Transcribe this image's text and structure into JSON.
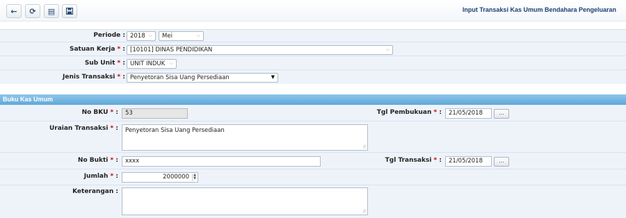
{
  "toolbar": {
    "buttons": [
      {
        "icon": "arrow-left-icon",
        "glyph": "←"
      },
      {
        "icon": "refresh-icon",
        "glyph": "⟳"
      },
      {
        "icon": "list-icon",
        "glyph": "▤"
      },
      {
        "icon": "save-icon",
        "glyph": "▪"
      }
    ]
  },
  "page_title": "Input Transaksi Kas Umum Bendahara Pengeluaran",
  "filter": {
    "periode_label": "Periode :",
    "periode_year": "2018",
    "periode_month": "Mei",
    "satuan_kerja_label": "Satuan Kerja",
    "satuan_kerja_value": "[10101] DINAS PENDIDIKAN",
    "sub_unit_label": "Sub Unit",
    "sub_unit_value": "UNIT INDUK",
    "jenis_transaksi_label": "Jenis Transaksi",
    "jenis_transaksi_value": "Penyetoran Sisa Uang Persediaan"
  },
  "section_title": "Buku Kas Umum",
  "bku": {
    "no_bku_label": "No BKU",
    "no_bku_value": "53",
    "tgl_pembukuan_label": "Tgl Pembukuan",
    "tgl_pembukuan_value": "21/05/2018",
    "uraian_label": "Uraian Transaksi",
    "uraian_value": "Penyetoran Sisa Uang Persediaan",
    "no_bukti_label": "No Bukti",
    "no_bukti_value": "xxxx",
    "tgl_transaksi_label": "Tgl Transaksi",
    "tgl_transaksi_value": "21/05/2018",
    "jumlah_label": "Jumlah",
    "jumlah_value": "2000000",
    "keterangan_label": "Keterangan :",
    "keterangan_value": "",
    "calendar_button": "..."
  },
  "colors": {
    "title": "#1f3f73",
    "section_header": "#5fa8d8",
    "panel_bg": "#eef3fa",
    "required": "#d10000"
  }
}
